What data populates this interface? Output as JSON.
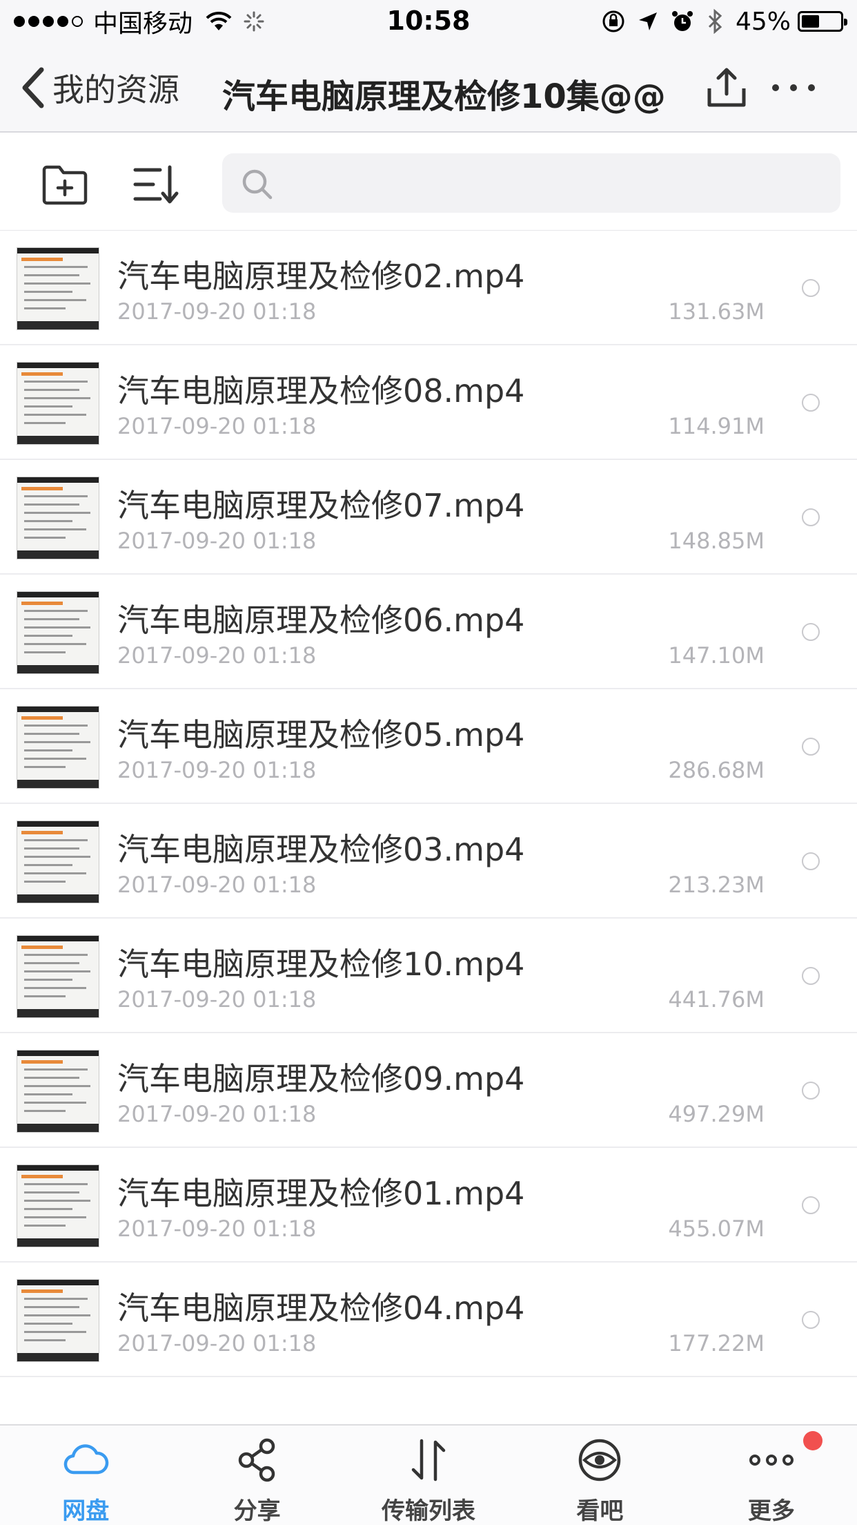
{
  "status_bar": {
    "carrier": "中国移动",
    "time": "10:58",
    "battery": "45%",
    "battery_level": 0.45
  },
  "nav": {
    "back_label": "我的资源",
    "title": "汽车电脑原理及检修10集@@"
  },
  "search": {
    "placeholder": ""
  },
  "files": [
    {
      "name": "汽车电脑原理及检修02.mp4",
      "date": "2017-09-20 01:18",
      "size": "131.63M"
    },
    {
      "name": "汽车电脑原理及检修08.mp4",
      "date": "2017-09-20 01:18",
      "size": "114.91M"
    },
    {
      "name": "汽车电脑原理及检修07.mp4",
      "date": "2017-09-20 01:18",
      "size": "148.85M"
    },
    {
      "name": "汽车电脑原理及检修06.mp4",
      "date": "2017-09-20 01:18",
      "size": "147.10M"
    },
    {
      "name": "汽车电脑原理及检修05.mp4",
      "date": "2017-09-20 01:18",
      "size": "286.68M"
    },
    {
      "name": "汽车电脑原理及检修03.mp4",
      "date": "2017-09-20 01:18",
      "size": "213.23M"
    },
    {
      "name": "汽车电脑原理及检修10.mp4",
      "date": "2017-09-20 01:18",
      "size": "441.76M"
    },
    {
      "name": "汽车电脑原理及检修09.mp4",
      "date": "2017-09-20 01:18",
      "size": "497.29M"
    },
    {
      "name": "汽车电脑原理及检修01.mp4",
      "date": "2017-09-20 01:18",
      "size": "455.07M"
    },
    {
      "name": "汽车电脑原理及检修04.mp4",
      "date": "2017-09-20 01:18",
      "size": "177.22M"
    }
  ],
  "tabs": [
    {
      "label": "网盘",
      "icon": "cloud-icon",
      "active": true
    },
    {
      "label": "分享",
      "icon": "share-icon",
      "active": false
    },
    {
      "label": "传输列表",
      "icon": "transfer-icon",
      "active": false
    },
    {
      "label": "看吧",
      "icon": "eye-icon",
      "active": false
    },
    {
      "label": "更多",
      "icon": "more-icon",
      "active": false,
      "badge": true
    }
  ],
  "colors": {
    "accent": "#3a9bf0",
    "badge": "#f1504f",
    "secondary_text": "#b4b4b8"
  }
}
